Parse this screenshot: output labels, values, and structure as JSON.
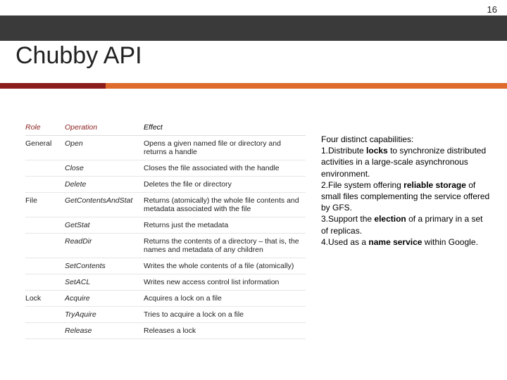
{
  "page_number": "16",
  "title": "Chubby API",
  "table": {
    "headers": {
      "role": "Role",
      "operation": "Operation",
      "effect": "Effect"
    },
    "rows": [
      {
        "role": "General",
        "op": "Open",
        "eff": "Opens a given named file or directory and returns a handle"
      },
      {
        "role": "",
        "op": "Close",
        "eff": "Closes the file associated with the handle"
      },
      {
        "role": "",
        "op": "Delete",
        "eff": "Deletes the file or directory"
      },
      {
        "role": "File",
        "op": "GetContentsAndStat",
        "eff": "Returns (atomically) the whole file contents and metadata associated with the file"
      },
      {
        "role": "",
        "op": "GetStat",
        "eff": "Returns just the metadata"
      },
      {
        "role": "",
        "op": "ReadDir",
        "eff": "Returns the contents of a directory – that is, the names and metadata of any children"
      },
      {
        "role": "",
        "op": "SetContents",
        "eff": "Writes the whole contents of a file (atomically)"
      },
      {
        "role": "",
        "op": "SetACL",
        "eff": "Writes new access control list information"
      },
      {
        "role": "Lock",
        "op": "Acquire",
        "eff": "Acquires a lock on a file"
      },
      {
        "role": "",
        "op": "TryAquire",
        "eff": "Tries to acquire a lock on a file"
      },
      {
        "role": "",
        "op": "Release",
        "eff": "Releases a lock"
      }
    ]
  },
  "caps": {
    "heading": "Four distinct capabilities:",
    "items": [
      {
        "n": "1.",
        "pre": "Distribute ",
        "b": "locks",
        "post": " to synchronize distributed activities in a large-scale asynchronous environment."
      },
      {
        "n": "2.",
        "pre": "File system offering ",
        "b": "reliable storage",
        "post": " of small files complementing the service offered by GFS."
      },
      {
        "n": "3.",
        "pre": "Support the ",
        "b": "election",
        "post": " of a primary in a set of replicas."
      },
      {
        "n": "4.",
        "pre": "Used as a ",
        "b": "name service",
        "post": " within Google."
      }
    ]
  }
}
